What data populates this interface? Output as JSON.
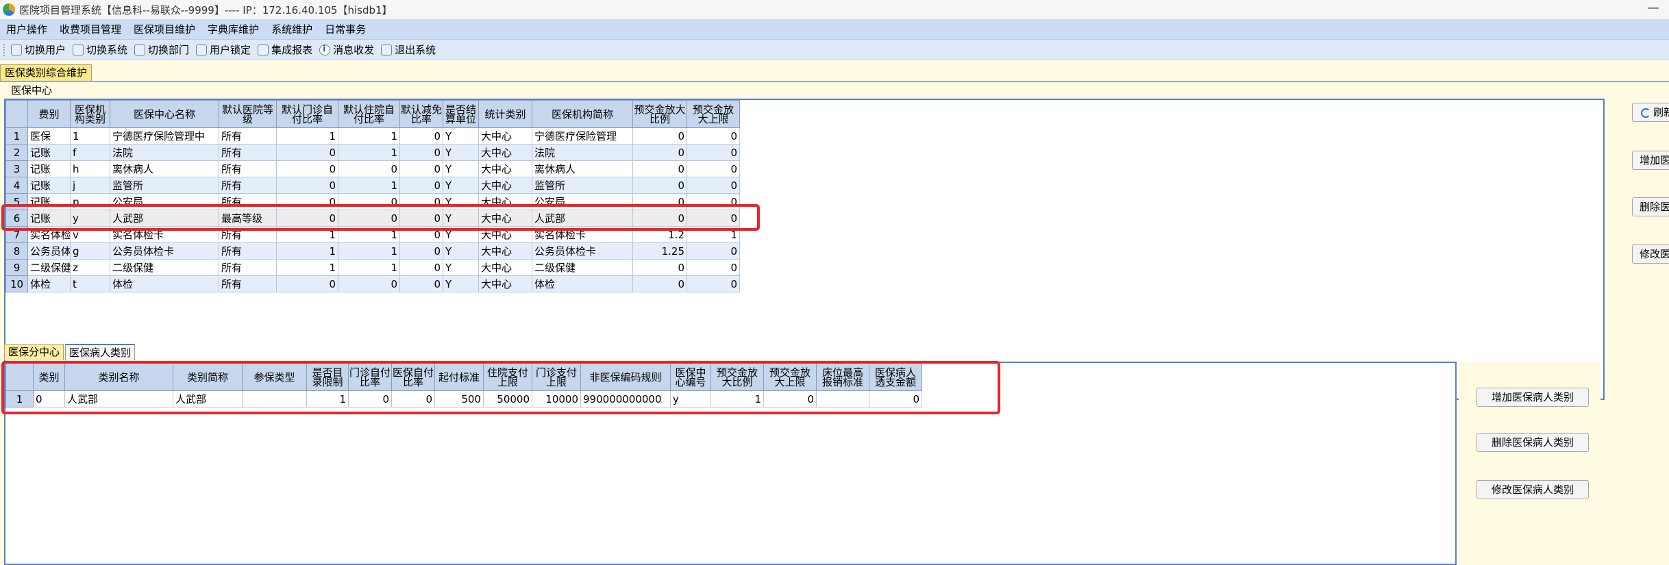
{
  "window": {
    "title": "医院项目管理系统【信息科--易联众--9999】---- IP：172.16.40.105【hisdb1】",
    "minimize_label": "—"
  },
  "menu": [
    "用户操作",
    "收费项目管理",
    "医保项目维护",
    "字典库维护",
    "系统维护",
    "日常事务"
  ],
  "toolbar": [
    {
      "label": "切换用户",
      "icon": "switch-user-icon"
    },
    {
      "label": "切换系统",
      "icon": "switch-system-icon"
    },
    {
      "label": "切换部门",
      "icon": "switch-dept-icon"
    },
    {
      "label": "用户锁定",
      "icon": "user-lock-icon"
    },
    {
      "label": "集成报表",
      "icon": "report-icon"
    },
    {
      "label": "消息收发",
      "icon": "info-icon"
    },
    {
      "label": "退出系统",
      "icon": "exit-icon"
    }
  ],
  "document_tab": "医保类别综合维护",
  "group_title": "医保中心",
  "center_table": {
    "columns": [
      "费别",
      "医保机构类别",
      "医保中心名称",
      "默认医院等级",
      "默认门诊自付比率",
      "默认住院自付比率",
      "默认减免比率",
      "是否结算单位",
      "统计类别",
      "医保机构简称",
      "预交金放大比例",
      "预交金放大上限"
    ],
    "rows": [
      [
        "医保",
        "1",
        "宁德医疗保险管理中",
        "所有",
        "1",
        "1",
        "0",
        "Y",
        "大中心",
        "宁德医疗保险管理",
        "0",
        "0"
      ],
      [
        "记账",
        "f",
        "法院",
        "所有",
        "0",
        "1",
        "0",
        "Y",
        "大中心",
        "法院",
        "0",
        "0"
      ],
      [
        "记账",
        "h",
        "离休病人",
        "所有",
        "0",
        "0",
        "0",
        "Y",
        "大中心",
        "离休病人",
        "0",
        "0"
      ],
      [
        "记账",
        "j",
        "监管所",
        "所有",
        "0",
        "1",
        "0",
        "Y",
        "大中心",
        "监管所",
        "0",
        "0"
      ],
      [
        "记账",
        "p",
        "公安局",
        "所有",
        "0",
        "0",
        "0",
        "Y",
        "大中心",
        "公安局",
        "0",
        "0"
      ],
      [
        "记账",
        "y",
        "人武部",
        "最高等级",
        "0",
        "0",
        "0",
        "Y",
        "大中心",
        "人武部",
        "0",
        "0"
      ],
      [
        "实名体检",
        "v",
        "实名体检卡",
        "所有",
        "1",
        "1",
        "0",
        "Y",
        "大中心",
        "实名体检卡",
        "1.2",
        "1"
      ],
      [
        "公务员体检",
        "g",
        "公务员体检卡",
        "所有",
        "1",
        "1",
        "0",
        "Y",
        "大中心",
        "公务员体检卡",
        "1.25",
        "0"
      ],
      [
        "二级保健",
        "z",
        "二级保健",
        "所有",
        "1",
        "1",
        "0",
        "Y",
        "大中心",
        "二级保健",
        "0",
        "0"
      ],
      [
        "体检",
        "t",
        "体检",
        "所有",
        "0",
        "0",
        "0",
        "Y",
        "大中心",
        "体检",
        "0",
        "0"
      ]
    ],
    "selected_row": 6
  },
  "right_buttons_top": [
    {
      "label": "刷新"
    },
    {
      "label": "增加医保中心"
    },
    {
      "label": "删除医保中心"
    },
    {
      "label": "修改医保中心"
    }
  ],
  "lower_tabs": [
    "医保分中心",
    "医保病人类别"
  ],
  "patient_table": {
    "columns": [
      "类别",
      "类别名称",
      "类别简称",
      "参保类型",
      "是否目录限制",
      "门诊自付比率",
      "医保自付比率",
      "起付标准",
      "住院支付上限",
      "门诊支付上限",
      "非医保编码规则",
      "医保中心编号",
      "预交金放大比例",
      "预交金放大上限",
      "床位最高报销标准",
      "医保病人透支金额"
    ],
    "rows": [
      [
        "0",
        "人武部",
        "人武部",
        "",
        "1",
        "0",
        "0",
        "500",
        "50000",
        "10000",
        "990000000000",
        "y",
        "1",
        "0",
        "",
        "0"
      ]
    ]
  },
  "right_buttons_bottom": [
    {
      "label": "增加医保病人类别"
    },
    {
      "label": "删除医保病人类别"
    },
    {
      "label": "修改医保病人类别"
    }
  ]
}
